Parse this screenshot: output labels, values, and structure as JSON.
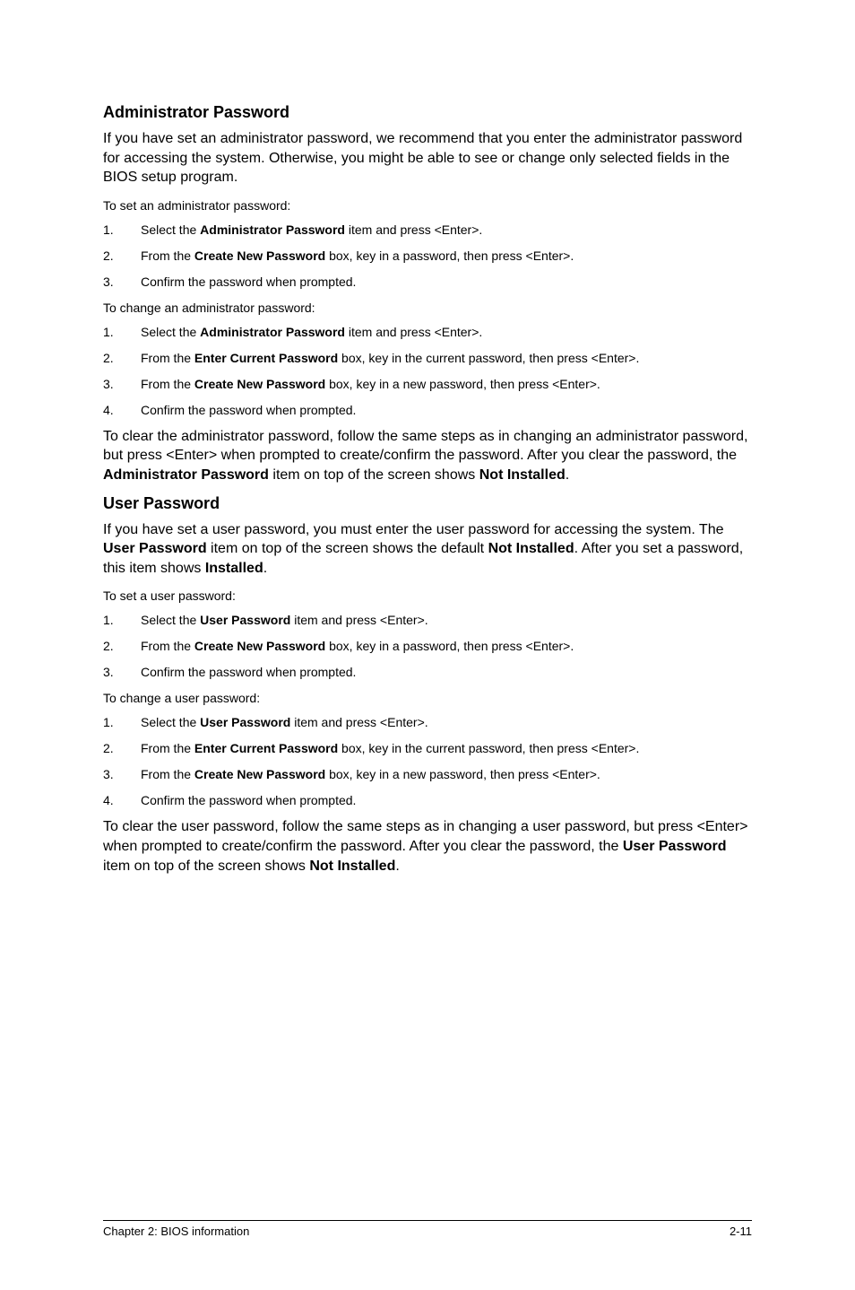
{
  "section1": {
    "heading": "Administrator Password",
    "intro": "If you have set an administrator password, we recommend that you enter the administrator password for accessing the system. Otherwise, you might be able to see or change only selected fields in the BIOS setup program.",
    "set_label": "To set an administrator password:",
    "set_steps": [
      {
        "num": "1.",
        "pre": "Select the ",
        "bold": "Administrator Password",
        "post": " item and press <Enter>."
      },
      {
        "num": "2.",
        "pre": "From the ",
        "bold": "Create New Password",
        "post": " box, key in a password, then press <Enter>."
      },
      {
        "num": "3.",
        "pre": "Confirm the password when prompted.",
        "bold": "",
        "post": ""
      }
    ],
    "change_label": "To change an administrator password:",
    "change_steps": [
      {
        "num": "1.",
        "pre": "Select the ",
        "bold": "Administrator Password",
        "post": " item and press <Enter>."
      },
      {
        "num": "2.",
        "pre": "From the ",
        "bold": "Enter Current Password",
        "post": " box, key in the current password, then press <Enter>."
      },
      {
        "num": "3.",
        "pre": "From the ",
        "bold": "Create New Password",
        "post": " box, key in a new password, then press <Enter>."
      },
      {
        "num": "4.",
        "pre": "Confirm the password when prompted.",
        "bold": "",
        "post": ""
      }
    ],
    "clear_pre": "To clear the administrator password, follow the same steps as in changing an administrator password, but press <Enter> when prompted to create/confirm the password. After you clear the password, the ",
    "clear_bold1": "Administrator Password",
    "clear_mid": " item on top of the screen shows ",
    "clear_bold2": "Not Installed",
    "clear_post": "."
  },
  "section2": {
    "heading": "User Password",
    "intro_pre": "If you have set a user password, you must enter the user password for accessing the system. The ",
    "intro_bold1": "User Password",
    "intro_mid1": " item on top of the screen shows the default ",
    "intro_bold2": "Not Installed",
    "intro_mid2": ". After you set a password, this item shows ",
    "intro_bold3": "Installed",
    "intro_post": ".",
    "set_label": "To set a user password:",
    "set_steps": [
      {
        "num": "1.",
        "pre": "Select the ",
        "bold": "User Password",
        "post": " item and press <Enter>."
      },
      {
        "num": "2.",
        "pre": "From the ",
        "bold": "Create New Password",
        "post": " box, key in a password, then press <Enter>."
      },
      {
        "num": "3.",
        "pre": "Confirm the password when prompted.",
        "bold": "",
        "post": ""
      }
    ],
    "change_label": "To change a user password:",
    "change_steps": [
      {
        "num": "1.",
        "pre": "Select the ",
        "bold": "User Password",
        "post": " item and press <Enter>."
      },
      {
        "num": "2.",
        "pre": "From the ",
        "bold": "Enter Current Password",
        "post": " box, key in the current password, then press <Enter>."
      },
      {
        "num": "3.",
        "pre": "From the ",
        "bold": "Create New Password",
        "post": " box, key in a new password, then press <Enter>."
      },
      {
        "num": "4.",
        "pre": "Confirm the password when prompted.",
        "bold": "",
        "post": ""
      }
    ],
    "clear_pre": "To clear the user password, follow the same steps as in changing a user password, but press <Enter> when prompted to create/confirm the password. After you clear the password, the ",
    "clear_bold1": "User Password",
    "clear_mid": " item on top of the screen shows ",
    "clear_bold2": "Not Installed",
    "clear_post": "."
  },
  "footer": {
    "left": "Chapter 2: BIOS information",
    "right": "2-11"
  }
}
